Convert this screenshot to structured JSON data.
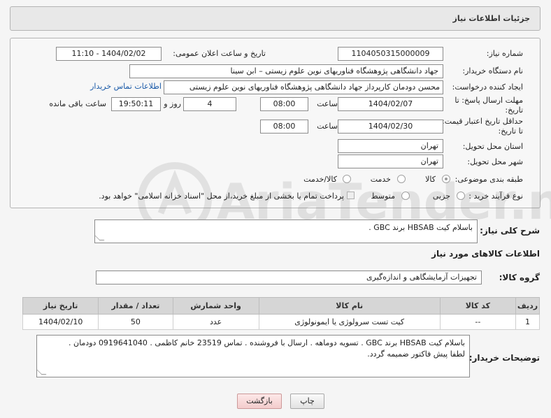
{
  "header": {
    "title": "جزئیات اطلاعات نیاز"
  },
  "fields": {
    "need_number_label": "شماره نیاز:",
    "need_number": "1104050315000009",
    "announce_label": "تاریخ و ساعت اعلان عمومی:",
    "announce_value": "1404/02/02 - 11:10",
    "buyer_org_label": "نام دستگاه خریدار:",
    "buyer_org": "جهاد دانشگاهی پژوهشگاه فناوریهای نوین علوم زیستی – ابن سینا",
    "requester_label": "ایجاد کننده درخواست:",
    "requester": "محسن دودمان کارپرداز جهاد دانشگاهی پژوهشگاه فناوریهای نوین علوم زیستی",
    "contact_link": "اطلاعات تماس خریدار",
    "deadline_label_1": "مهلت ارسال پاسخ: تا",
    "deadline_label_2": "تاریخ:",
    "deadline_date": "1404/02/07",
    "time_label": "ساعت",
    "deadline_time": "08:00",
    "days_value": "4",
    "days_label": "روز و",
    "remaining_time": "19:50:11",
    "remaining_label": "ساعت باقی مانده",
    "validity_label_1": "حداقل تاریخ اعتبار قیمت:",
    "validity_label_2": "تا تاریخ:",
    "validity_date": "1404/02/30",
    "validity_time": "08:00",
    "province_label": "استان محل تحویل:",
    "province": "تهران",
    "city_label": "شهر محل تحویل:",
    "city": "تهران",
    "category_label": "طبقه بندی موضوعی:",
    "category_options": [
      "کالا",
      "خدمت",
      "کالا/خدمت"
    ],
    "process_label": "نوع فرآیند خرید :",
    "process_options": [
      "جزیی",
      "متوسط"
    ],
    "payment_note": "پرداخت تمام یا بخشی از مبلغ خرید،از محل \"اسناد خزانه اسلامی\" خواهد بود."
  },
  "summary": {
    "label": "شرح کلی نیاز:",
    "text": "باسلام کیت HBSAB برند GBC ."
  },
  "goods": {
    "section_title": "اطلاعات کالاهای مورد نیاز",
    "group_label": "گروه کالا:",
    "group_value": "تجهیزات آزمایشگاهی و اندازه‌گیری",
    "columns": [
      "ردیف",
      "کد کالا",
      "نام کالا",
      "واحد شمارش",
      "تعداد / مقدار",
      "تاریخ نیاز"
    ],
    "rows": [
      [
        "1",
        "--",
        "کیت تست سرولوژی یا ایمونولوژی",
        "عدد",
        "50",
        "1404/02/10"
      ]
    ]
  },
  "buyer_notes": {
    "label": "توضیحات خریدار:",
    "line1": "باسلام کیت HBSAB برند GBC . تسویه دوماهه . ارسال با فروشنده . تماس 23519 خانم کاظمی . 0919641040 دودمان .",
    "line2": "لطفا پیش فاکتور ضمیمه گردد."
  },
  "buttons": {
    "print": "چاپ",
    "back": "بازگشت"
  },
  "watermark": {
    "text": "AriaTender.net"
  }
}
